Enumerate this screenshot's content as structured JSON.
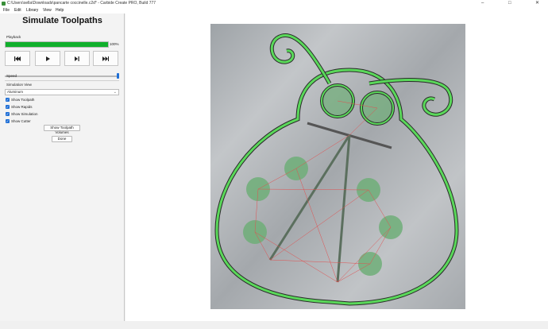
{
  "window": {
    "title": "C:\\Users\\sella\\Downloads\\pancarte coccinelle.c2d* - Carbide Create PRO, Build 777",
    "minimize_glyph": "–",
    "maximize_glyph": "□",
    "close_glyph": "✕"
  },
  "menu": {
    "items": [
      "File",
      "Edit",
      "Library",
      "View",
      "Help"
    ]
  },
  "panel": {
    "title": "Simulate Toolpaths",
    "playback_label": "Playback",
    "progress": {
      "value": 100,
      "text": "100%"
    },
    "playback_buttons": [
      {
        "name": "rewind",
        "icon": "skip-back-icon"
      },
      {
        "name": "play",
        "icon": "play-icon"
      },
      {
        "name": "step",
        "icon": "skip-forward-icon"
      },
      {
        "name": "fast-forward",
        "icon": "fast-forward-icon"
      }
    ],
    "speed_label": "Speed",
    "speed_value": 1.0,
    "simulation_view_label": "Simulation View",
    "material_selected": "Aluminum",
    "checkboxes": [
      {
        "label": "Show Toolpath",
        "checked": true
      },
      {
        "label": "Show Rapids",
        "checked": true
      },
      {
        "label": "Show Simulation",
        "checked": true
      },
      {
        "label": "Show Cutter",
        "checked": true
      }
    ],
    "volumes_button": "Show Toolpath Volumes",
    "done_button": "Done"
  },
  "colors": {
    "progress": "#11b02c",
    "accent": "#1f6fd6",
    "stock": "#a8acb0",
    "toolpath": "#5ad85a",
    "rapid": "#e05050",
    "pocket": "#6fae78"
  }
}
